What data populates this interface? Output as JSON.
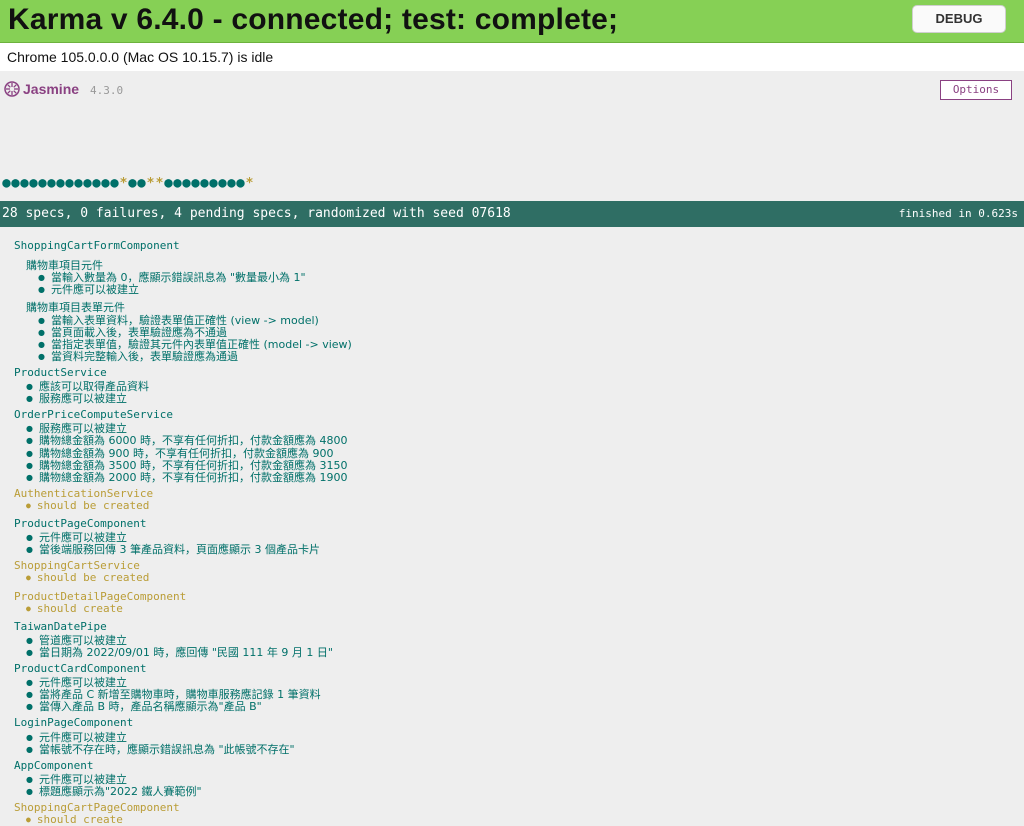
{
  "karma": {
    "title": "Karma v 6.4.0 - connected; test: complete;",
    "debug_label": "DEBUG",
    "browser_status": "Chrome 105.0.0.0 (Mac OS 10.15.7) is idle",
    "banner_color": "#86d055"
  },
  "jasmine": {
    "logo_text": "Jasmine",
    "version": "4.3.0",
    "options_label": "Options",
    "dots": [
      "p",
      "p",
      "p",
      "p",
      "p",
      "p",
      "p",
      "p",
      "p",
      "p",
      "p",
      "p",
      "p",
      "*",
      "p",
      "p",
      "*",
      "*",
      "p",
      "p",
      "p",
      "p",
      "p",
      "p",
      "p",
      "p",
      "p",
      "*"
    ],
    "summary": "28 specs, 0 failures, 4 pending specs, randomized with seed 07618",
    "duration": "finished in 0.623s",
    "colors": {
      "passed": "#007069",
      "pending": "#ba9d37",
      "bar": "#2f6e64",
      "brand": "#8a4182"
    }
  },
  "results": [
    {
      "name": "ShoppingCartFormComponent",
      "pending": false
    },
    {
      "name": "購物車項目元件",
      "pending": false,
      "level": 1
    },
    {
      "spec": "當輸入數量為 0，應顯示錯誤訊息為 \"數量最小為 1\"",
      "pending": false,
      "level": 2
    },
    {
      "spec": "元件應可以被建立",
      "pending": false,
      "level": 2
    },
    {
      "name": "購物車項目表單元件",
      "pending": false,
      "level": 1
    },
    {
      "spec": "當輸入表單資料，驗證表單值正確性 (view -> model)",
      "pending": false,
      "level": 2
    },
    {
      "spec": "當頁面載入後，表單驗證應為不通過",
      "pending": false,
      "level": 2
    },
    {
      "spec": "當指定表單值，驗證其元件內表單值正確性 (model -> view)",
      "pending": false,
      "level": 2
    },
    {
      "spec": "當資料完整輸入後，表單驗證應為通過",
      "pending": false,
      "level": 2
    },
    {
      "name": "ProductService",
      "pending": false
    },
    {
      "spec": "應該可以取得產品資料",
      "pending": false
    },
    {
      "spec": "服務應可以被建立",
      "pending": false
    },
    {
      "name": "OrderPriceComputeService",
      "pending": false
    },
    {
      "spec": "服務應可以被建立",
      "pending": false
    },
    {
      "spec": "購物總金額為 6000 時，不享有任何折扣，付款金額應為 4800",
      "pending": false
    },
    {
      "spec": "購物總金額為 900 時，不享有任何折扣，付款金額應為 900",
      "pending": false
    },
    {
      "spec": "購物總金額為 3500 時，不享有任何折扣，付款金額應為 3150",
      "pending": false
    },
    {
      "spec": "購物總金額為 2000 時，不享有任何折扣，付款金額應為 1900",
      "pending": false
    },
    {
      "name": "AuthenticationService",
      "pending": true
    },
    {
      "spec": "should be created",
      "pending": true
    },
    {
      "name": "ProductPageComponent",
      "pending": false
    },
    {
      "spec": "元件應可以被建立",
      "pending": false
    },
    {
      "spec": "當後端服務回傳 3 筆產品資料，頁面應顯示 3 個產品卡片",
      "pending": false
    },
    {
      "name": "ShoppingCartService",
      "pending": true
    },
    {
      "spec": "should be created",
      "pending": true
    },
    {
      "name": "ProductDetailPageComponent",
      "pending": true
    },
    {
      "spec": "should create",
      "pending": true
    },
    {
      "name": "TaiwanDatePipe",
      "pending": false
    },
    {
      "spec": "管道應可以被建立",
      "pending": false
    },
    {
      "spec": "當日期為 2022/09/01 時，應回傳 \"民國 111 年 9 月 1 日\"",
      "pending": false
    },
    {
      "name": "ProductCardComponent",
      "pending": false
    },
    {
      "spec": "元件應可以被建立",
      "pending": false
    },
    {
      "spec": "當將產品 C 新增至購物車時，購物車服務應記錄 1 筆資料",
      "pending": false
    },
    {
      "spec": "當傳入產品 B 時，產品名稱應顯示為\"產品 B\"",
      "pending": false
    },
    {
      "name": "LoginPageComponent",
      "pending": false
    },
    {
      "spec": "元件應可以被建立",
      "pending": false
    },
    {
      "spec": "當帳號不存在時，應顯示錯誤訊息為 \"此帳號不存在\"",
      "pending": false
    },
    {
      "name": "AppComponent",
      "pending": false
    },
    {
      "spec": "元件應可以被建立",
      "pending": false
    },
    {
      "spec": "標題應顯示為\"2022 鐵人賽範例\"",
      "pending": false
    },
    {
      "name": "ShoppingCartPageComponent",
      "pending": true
    },
    {
      "spec": "should create",
      "pending": true
    }
  ]
}
